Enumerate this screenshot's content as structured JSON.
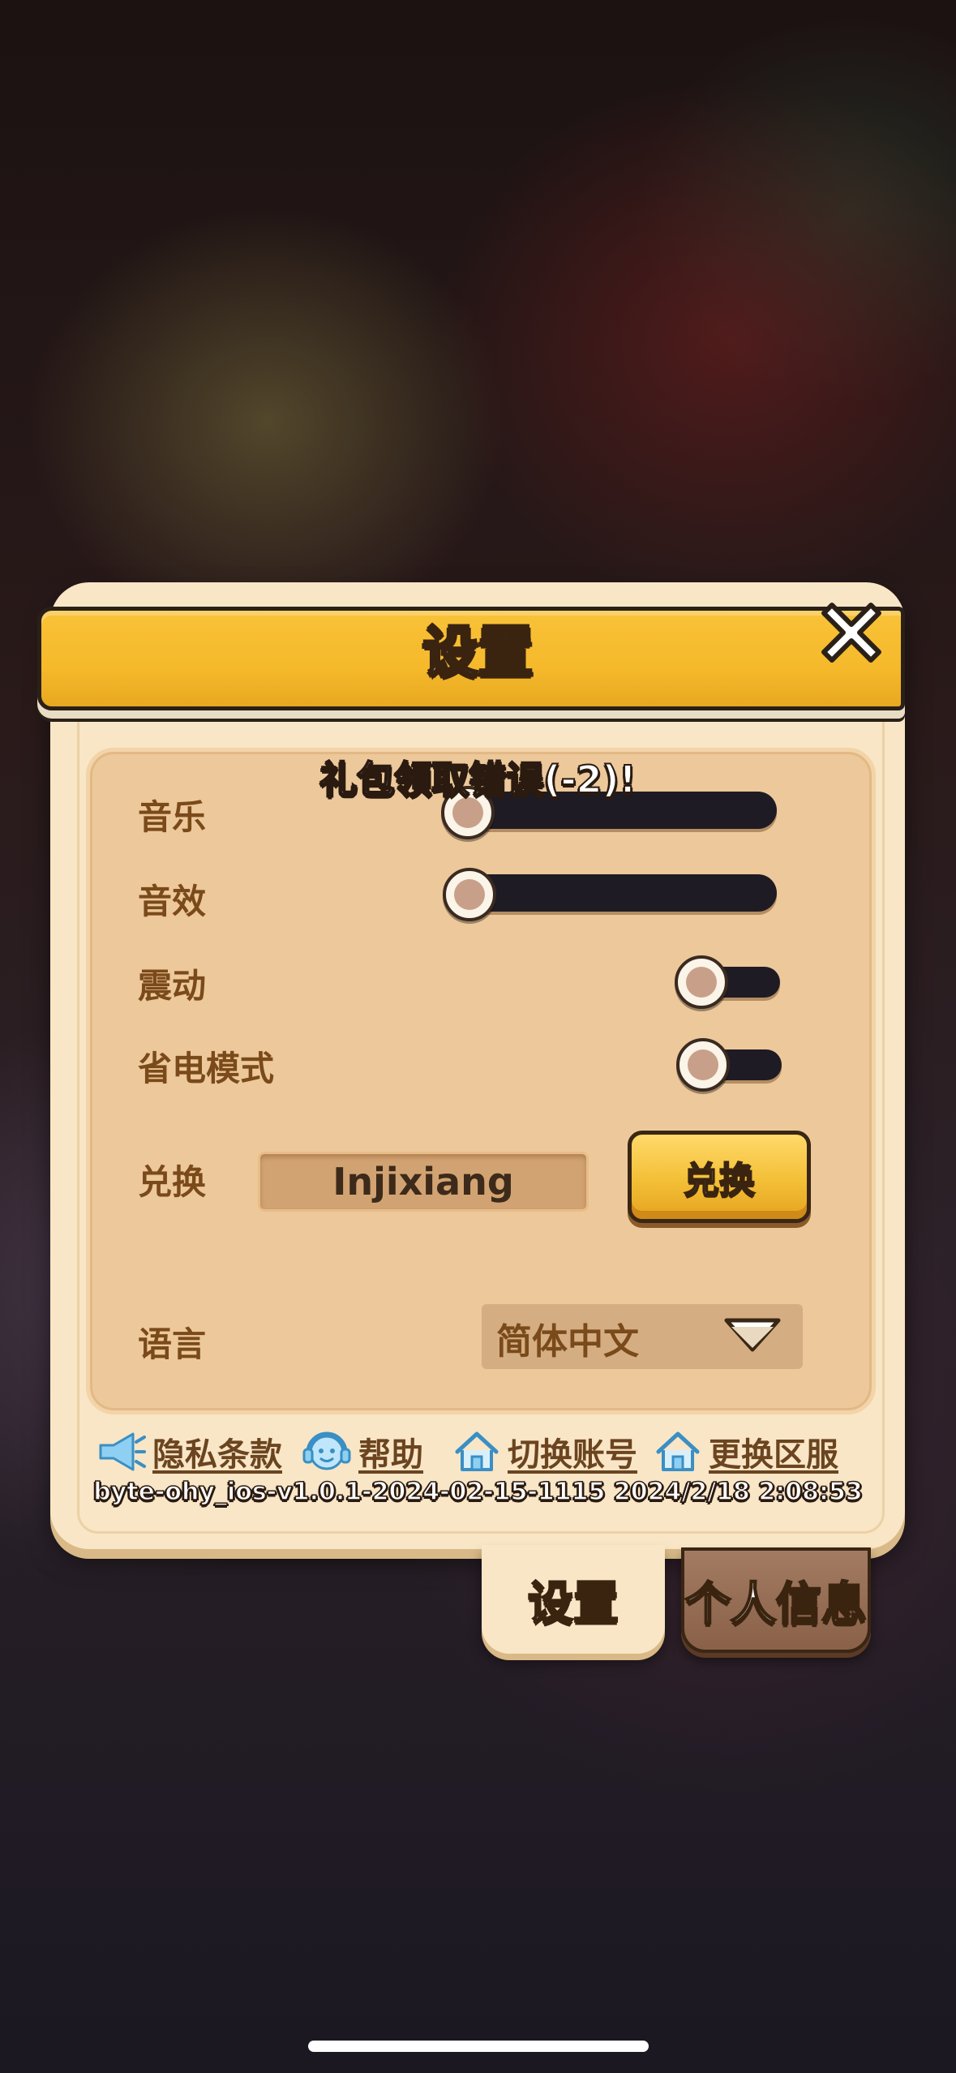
{
  "dialog": {
    "title": "设置",
    "toast": "礼包领取错误(-2)!"
  },
  "settings": {
    "music_label": "音乐",
    "music_level": 0.0,
    "sfx_label": "音效",
    "sfx_level": 0.0,
    "vibration_label": "震动",
    "vibration_on": false,
    "power_saving_label": "省电模式",
    "power_saving_on": false,
    "redeem_label": "兑换",
    "redeem_value": "Injixiang",
    "redeem_button": "兑换",
    "language_label": "语言",
    "language_value": "简体中文"
  },
  "links": [
    {
      "label": "隐私条款",
      "icon": "megaphone-icon"
    },
    {
      "label": "帮助",
      "icon": "headset-icon"
    },
    {
      "label": "切换账号",
      "icon": "home-icon"
    },
    {
      "label": "更换区服",
      "icon": "home-icon"
    }
  ],
  "version": "byte-ohy_ios-v1.0.1-2024-02-15-1115 2024/2/18 2:08:53",
  "tabs": {
    "settings": "设置",
    "profile": "个人信息"
  },
  "colors": {
    "panel": "#f8e6c6",
    "ribbon": "#f5b92b",
    "button_gold": "#f3bf36",
    "label_brown": "#7a4a1a",
    "icon_blue": "#63b8e8"
  }
}
